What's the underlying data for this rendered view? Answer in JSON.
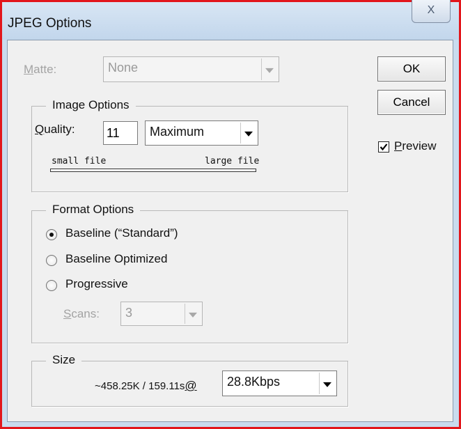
{
  "window": {
    "title": "JPEG Options",
    "close_glyph": "X"
  },
  "matte": {
    "label": "Matte:",
    "value": "None",
    "enabled": false
  },
  "image_options": {
    "legend": "Image Options",
    "quality_label": "Quality:",
    "quality_value": "11",
    "quality_preset": "Maximum",
    "slider_small": "small file",
    "slider_large": "large file",
    "slider_level_fraction": 0.917
  },
  "buttons": {
    "ok": "OK",
    "cancel": "Cancel"
  },
  "preview": {
    "label": "Preview",
    "checked": true
  },
  "format_options": {
    "legend": "Format Options",
    "choices": [
      {
        "label": "Baseline (“Standard”)",
        "selected": true
      },
      {
        "label": "Baseline Optimized",
        "selected": false
      },
      {
        "label": "Progressive",
        "selected": false
      }
    ],
    "scans_label": "Scans:",
    "scans_value": "3",
    "scans_enabled": false
  },
  "size": {
    "legend": "Size",
    "estimate": "~458.25K / 159.11s",
    "at": "@",
    "speed": "28.8Kbps"
  },
  "colors": {
    "frame_border": "#e2161c",
    "title_bg": "#c9dbee",
    "dialog_bg": "#f0f0f0"
  },
  "icons": {
    "close": "close-icon",
    "dropdown": "chevron-down-icon",
    "check": "check-icon"
  }
}
